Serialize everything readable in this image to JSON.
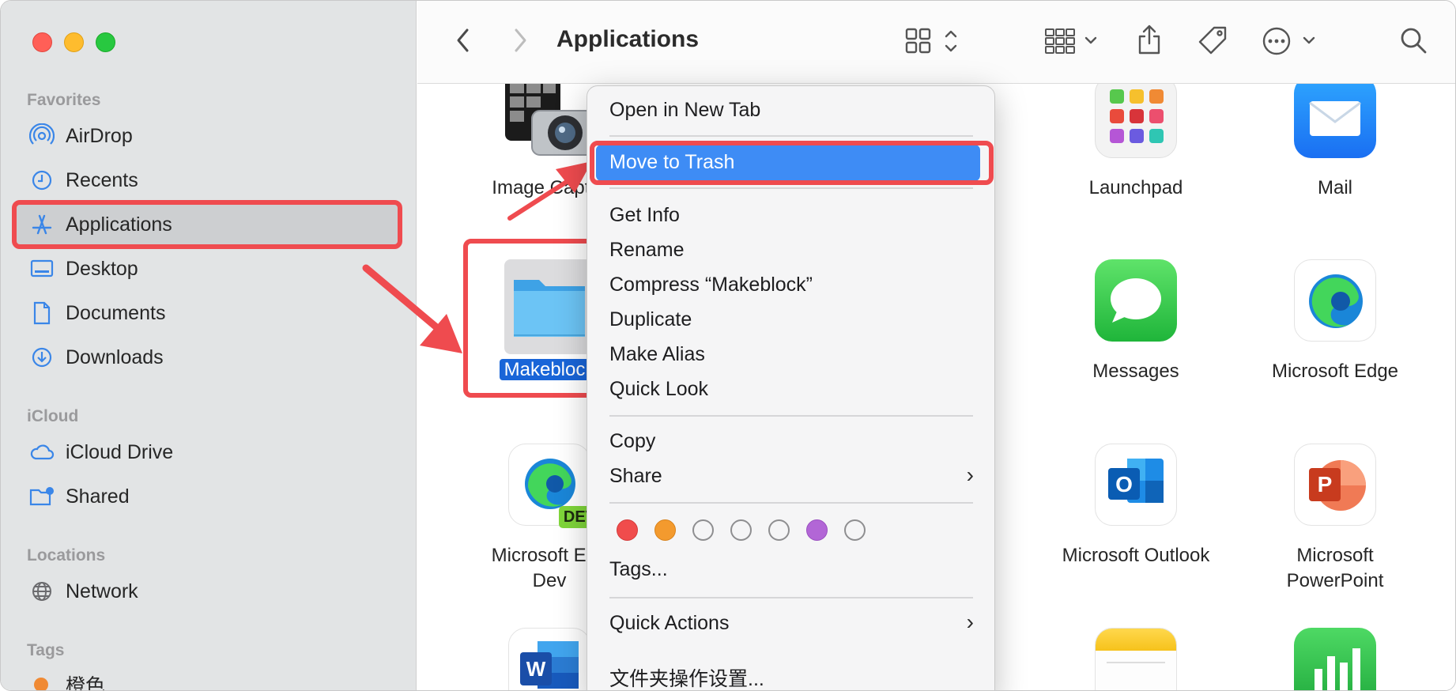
{
  "toolbar": {
    "title": "Applications"
  },
  "sidebar": {
    "favorites_title": "Favorites",
    "favorites": [
      {
        "label": "AirDrop",
        "icon": "airdrop-icon"
      },
      {
        "label": "Recents",
        "icon": "clock-icon"
      },
      {
        "label": "Applications",
        "icon": "applications-icon",
        "selected": true
      },
      {
        "label": "Desktop",
        "icon": "desktop-icon"
      },
      {
        "label": "Documents",
        "icon": "document-icon"
      },
      {
        "label": "Downloads",
        "icon": "download-icon"
      }
    ],
    "icloud_title": "iCloud",
    "icloud": [
      {
        "label": "iCloud Drive",
        "icon": "cloud-icon"
      },
      {
        "label": "Shared",
        "icon": "shared-folder-icon"
      }
    ],
    "locations_title": "Locations",
    "locations": [
      {
        "label": "Network",
        "icon": "globe-icon"
      }
    ],
    "tags_title": "Tags",
    "tags": [
      {
        "label": "橙色",
        "color": "#f08a34"
      }
    ]
  },
  "apps": [
    {
      "name": "Image Captur",
      "icon": "image-capture-icon"
    },
    {
      "name": "Launchpad",
      "icon": "launchpad-icon"
    },
    {
      "name": "Mail",
      "icon": "mail-icon"
    },
    {
      "name": "Makeblock",
      "icon": "folder-icon",
      "selected": true
    },
    {
      "name": "Messages",
      "icon": "messages-icon"
    },
    {
      "name": "Microsoft Edge",
      "icon": "edge-icon"
    },
    {
      "name": "Microsoft Edg",
      "name2": "Dev",
      "badge": "DEV",
      "icon": "edge-dev-icon"
    },
    {
      "name": "Microsoft Outlook",
      "icon": "outlook-icon"
    },
    {
      "name": "Microsoft",
      "name2": "PowerPoint",
      "icon": "powerpoint-icon"
    },
    {
      "name": "",
      "icon": "word-icon"
    },
    {
      "name": "",
      "icon": "notes-icon"
    },
    {
      "name": "",
      "icon": "numbers-icon"
    }
  ],
  "context_menu": {
    "open_new_tab": "Open in New Tab",
    "move_to_trash": "Move to Trash",
    "get_info": "Get Info",
    "rename": "Rename",
    "compress": "Compress “Makeblock”",
    "duplicate": "Duplicate",
    "make_alias": "Make Alias",
    "quick_look": "Quick Look",
    "copy": "Copy",
    "share": "Share",
    "tags": "Tags...",
    "quick_actions": "Quick Actions",
    "folder_settings": "文件夹操作设置...",
    "tag_colors": [
      "#f04c4c",
      "#f39a2e",
      "",
      "",
      "",
      "#b266d6",
      ""
    ]
  },
  "colors": {
    "selection_blue": "#3e8cf5",
    "highlight_red": "#ef4b4f",
    "folder_blue": "#5ab9f1"
  }
}
